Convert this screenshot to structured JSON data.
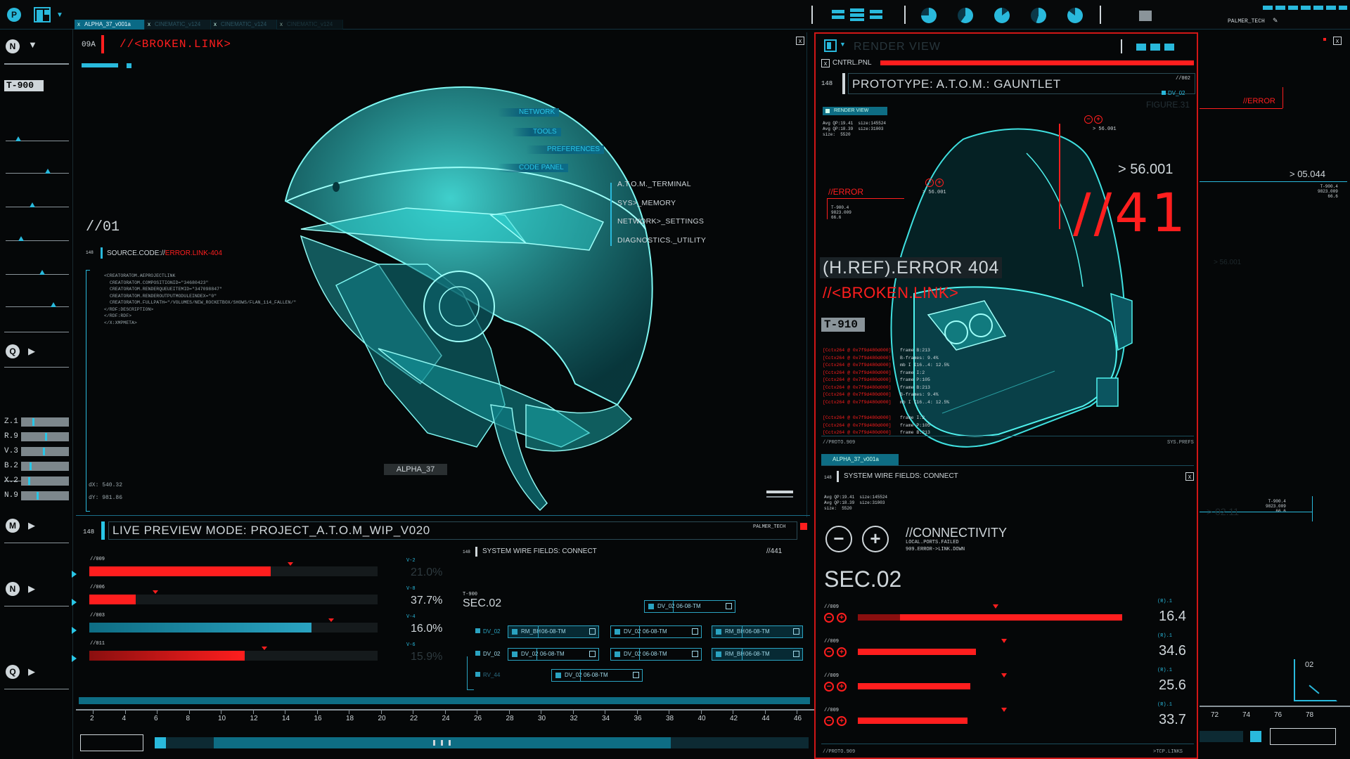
{
  "topbar": {
    "tabs": [
      "ALPHA_37_v001a",
      "CINEMATIC_v124",
      "CINEMATIC_v124",
      "CINEMATIC_v124"
    ],
    "user": "PALMER_TECH"
  },
  "left": {
    "logo_letter": "P",
    "groups": [
      "N",
      "Q",
      "M",
      "N",
      "Q"
    ],
    "model_tag": "T-900",
    "sliders": [
      {
        "label": "Z.1",
        "value": 0.25
      },
      {
        "label": "R.9",
        "value": 0.52
      },
      {
        "label": "V.3",
        "value": 0.48
      },
      {
        "label": "B.2",
        "value": 0.18
      },
      {
        "label": "X.2",
        "value": 0.15
      },
      {
        "label": "N.9",
        "value": 0.34
      }
    ]
  },
  "viewport": {
    "id": "09A",
    "broken": "//<BROKEN.LINK>",
    "index": "//01",
    "source_prefix": "SOURCE.CODE://",
    "source_error": "ERROR.LINK-404",
    "code_lines": [
      "<CREATORATOM.AEPROJECTLINK",
      "CREATORATOM.COMPOSITIONID=\"34680423\"",
      "CREATORATOM.RENDERQUEUEITEMID=\"347098847\"",
      "CREATORATOM.RENDEROUTPUTMODULEINDEX=\"0\"",
      "CREATORATOM.FULLPATH=\"/VOLUMES/NEW_ROCKETBOX/SHOWS/FLAN_114_FALLEN/\"",
      "</RDF:DESCRIPTION>",
      "</RDF:RDF>",
      "</X:XMPMETA>"
    ],
    "menu": [
      "NETWORK",
      "TOOLS",
      "PREFERENCES",
      "CODE PANEL"
    ],
    "system_list": [
      "A.T.O.M._TERMINAL",
      "SYS>_MEMORY",
      "NETWORK>_SETTINGS",
      "DIAGNOSTICS._UTILITY"
    ],
    "model_label": "ALPHA_37",
    "dx": "dX: 540.32",
    "dy": "dY: 981.86"
  },
  "preview": {
    "tag": "148",
    "title": "LIVE PREVIEW MODE: PROJECT_A.T.O.M_WIP_V020",
    "user": "PALMER_TECH",
    "rows": [
      {
        "code": "//009",
        "v": "V-2",
        "pct": "21.0%",
        "value": 0.63,
        "dim": true
      },
      {
        "code": "//006",
        "v": "V-8",
        "pct": "37.7%",
        "value": 0.16,
        "dim": false
      },
      {
        "code": "//003",
        "v": "V-4",
        "pct": "16.0%",
        "value": 0.77,
        "dim": false
      },
      {
        "code": "//011",
        "v": "V-6",
        "pct": "15.9%",
        "value": 0.54,
        "dim": true
      }
    ],
    "wire_tag": "148",
    "wire_title": "SYSTEM WIRE FIELDS: CONNECT",
    "wire_code": "//441",
    "model": "T-900",
    "sec": "SEC.02",
    "fields": [
      {
        "label": "DV_02",
        "date": "06-08-TM"
      },
      {
        "label": "RM_BH",
        "date": "06-08-TM"
      },
      {
        "label": "DV_02",
        "date": "06-08-TM"
      },
      {
        "label": "RM_BH",
        "date": "06-08-TM"
      },
      {
        "label": "DV_02",
        "date": "06-08-TM"
      },
      {
        "label": "DV_02",
        "date": "06-08-TM"
      },
      {
        "label": "RM_BH",
        "date": "06-08-TM"
      },
      {
        "label": "DV_02",
        "date": "06-08-TM"
      }
    ],
    "side_labels": [
      "DV_02",
      "DV_02",
      "RV_44"
    ]
  },
  "timeline": {
    "ticks": [
      "2",
      "4",
      "6",
      "8",
      "10",
      "12",
      "14",
      "16",
      "18",
      "20",
      "22",
      "24",
      "26",
      "28",
      "30",
      "32",
      "34",
      "36",
      "38",
      "40",
      "42",
      "44",
      "46"
    ],
    "right_ticks": [
      "72",
      "74",
      "76",
      "78"
    ]
  },
  "render": {
    "title": "RENDER VIEW",
    "ctrl": "CNTRL.PNL",
    "tag": "148",
    "prototype": "PROTOTYPE: A.T.O.M.: GAUNTLET",
    "proto_code": "//002",
    "render_label": "RENDER VIEW",
    "stats": "Avg QP:19.41  size:145524\nAvg QP:18.39  size:31003\nsize:  5520",
    "error": "//ERROR",
    "value_main": "> 56.001",
    "value_small": "> 56.001",
    "big": "//41",
    "error404": "(H.REF).ERROR 404",
    "broken": "//<BROKEN.LINK>",
    "model": "T-910",
    "figure": "FIGURE.31",
    "log_lines": [
      [
        "[Cctx264 @ 0x7f9d480d000]",
        "frame B:213"
      ],
      [
        "[Cctx264 @ 0x7f9d480d000]",
        "B-frames:  9.4%"
      ],
      [
        "[Cctx264 @ 0x7f9d480d000]",
        "mb I  I16..4: 12.5%"
      ],
      [
        "[Cctx264 @ 0x7f9d480d000]",
        "frame I:2"
      ],
      [
        "[Cctx264 @ 0x7f9d480d000]",
        "frame P:105"
      ],
      [
        "[Cctx264 @ 0x7f9d480d000]",
        "frame B:213"
      ],
      [
        "[Cctx264 @ 0x7f9d480d000]",
        "B-frames:  9.4%"
      ],
      [
        "[Cctx264 @ 0x7f9d480d000]",
        "mb I  I16..4: 12.5%"
      ],
      [
        "[Cctx264 @ 0x7f9d480d000]",
        "frame I:2"
      ],
      [
        "[Cctx264 @ 0x7f9d480d000]",
        "frame P:105"
      ],
      [
        "[Cctx264 @ 0x7f9d480d000]",
        "frame B:213"
      ]
    ],
    "foot_left": "//PROTO.909",
    "foot_right": "SYS.PREFS",
    "dv": "DV_02",
    "t_code": "T-900.4\n9823.009\n66.6"
  },
  "connect": {
    "tab": "ALPHA_37_v001a",
    "tag": "148",
    "title": "SYSTEM WIRE FIELDS: CONNECT",
    "stats": "Avg QP:19.41  size:145524\nAvg QP:18.39  size:31003\nsize:  5520",
    "heading": "//CONNECTIVITY",
    "sub1": "LOCAL.PORTS.FAILED",
    "sub2": "909.ERROR->LINK.DOWN",
    "sec": "SEC.02",
    "rows": [
      {
        "code": "//009",
        "tag": "(R).1",
        "value": "16.4",
        "fill": 0.94,
        "bright": true
      },
      {
        "code": "//009",
        "tag": "(R).1",
        "value": "34.6",
        "fill": 0.42,
        "bright": false
      },
      {
        "code": "//009",
        "tag": "(R).1",
        "value": "25.6",
        "fill": 0.4,
        "bright": false
      },
      {
        "code": "//009",
        "tag": "(R).1",
        "value": "33.7",
        "fill": 0.39,
        "bright": false
      }
    ],
    "foot_left": "//PROTO.909",
    "foot_right": ">TCP.LINKS"
  },
  "far_right": {
    "value": "> 05.044",
    "ghost": "> 56.001",
    "ghost2": "> 02.11",
    "code": "T-900.4\n9823.009\n66.6",
    "code2": "T-900.4\n9823.009\n66.6",
    "gauge": "02"
  }
}
